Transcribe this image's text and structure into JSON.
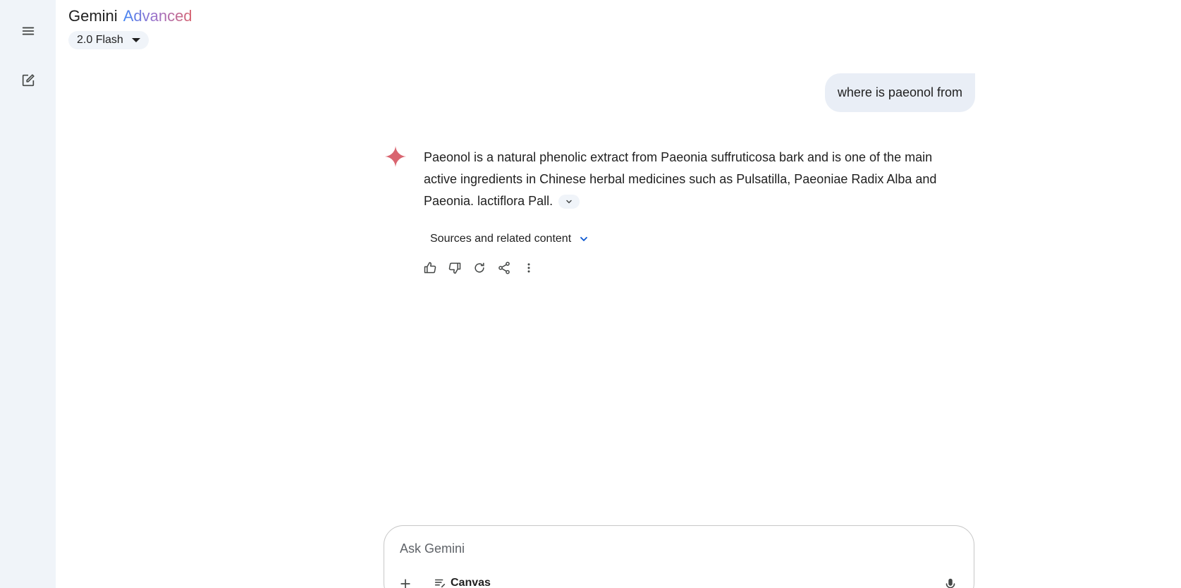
{
  "header": {
    "brand_name": "Gemini",
    "brand_tier": "Advanced",
    "model_selector": "2.0 Flash"
  },
  "sidebar": {
    "menu_icon": "menu-icon",
    "new_chat_icon": "edit-icon"
  },
  "conversation": {
    "user_message": "where is paeonol from",
    "response_text": "Paeonol is a natural phenolic extract from Paeonia suffruticosa bark and is one of the main active ingredients in Chinese herbal medicines such as Pulsatilla, Paeoniae Radix Alba and Paeonia. lactiflora Pall.",
    "sources_label": "Sources and related content",
    "actions": [
      "thumb-up-icon",
      "thumb-down-icon",
      "refresh-icon",
      "share-icon",
      "more-vert-icon"
    ]
  },
  "composer": {
    "placeholder": "Ask Gemini",
    "canvas_label": "Canvas"
  },
  "colors": {
    "sidebar_bg": "#f0f4f9",
    "bubble_bg": "#e9eef6",
    "spark": "#d96570",
    "advanced_gradient": [
      "#4285f4",
      "#9b72cb",
      "#d96570"
    ]
  }
}
